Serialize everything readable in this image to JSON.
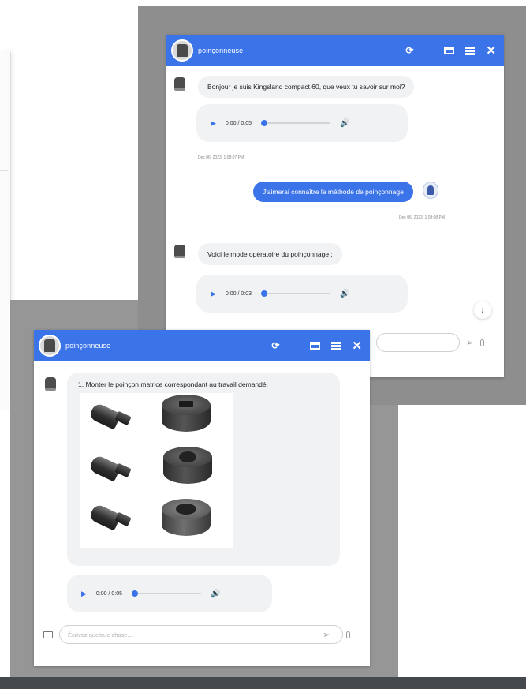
{
  "top_window": {
    "title": "poinçonneuse",
    "header_icons": [
      "refresh-icon",
      "grid-icon",
      "window-icon",
      "list-icon",
      "close-icon"
    ],
    "messages": [
      {
        "from": "bot",
        "text": "Bonjour je suis Kingsland compact 60, que veux tu savoir sur moi?"
      },
      {
        "from": "bot-audio",
        "time": "0:00 / 0:05"
      },
      {
        "timestamp": "Dec 06, 2023, 1:08:07 PM"
      },
      {
        "from": "user",
        "text": "J'aimerai connaître la méthode de poinçonnage"
      },
      {
        "timestamp": "Dec 06, 2023, 1:08:08 PM"
      },
      {
        "from": "bot",
        "text": "Voici le mode opératoire du poinçonnage :"
      },
      {
        "from": "bot-audio",
        "time": "0:00 / 0:03"
      }
    ]
  },
  "bottom_window": {
    "title": "poinçonneuse",
    "header_icons": [
      "refresh-icon",
      "grid-icon",
      "window-icon",
      "list-icon",
      "close-icon"
    ],
    "instruction": "1. Monter le poinçon matrice correspondant au travail demandé.",
    "audio_time": "0:00 / 0:05",
    "input_placeholder": "Écrivez quelque chose..."
  },
  "colors": {
    "header_blue": "#3b73e8",
    "bubble_gray": "#f1f2f4",
    "frame_gray": "#8e8e8e"
  }
}
